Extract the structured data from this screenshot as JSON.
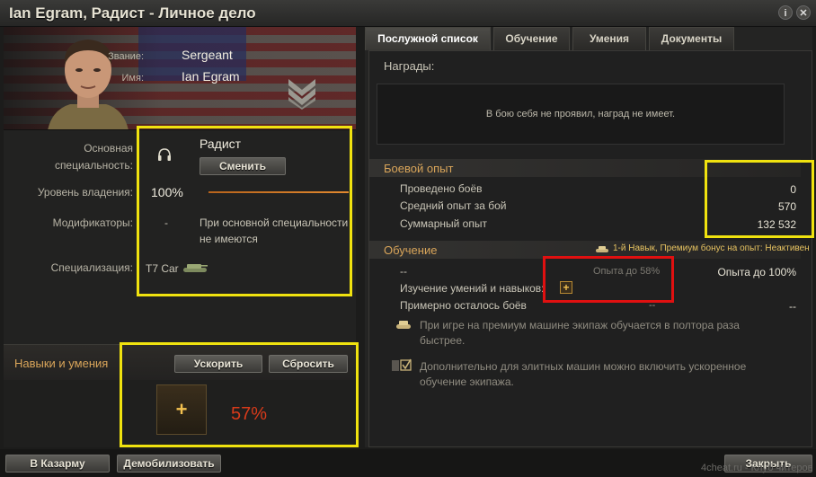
{
  "window": {
    "title": "Ian Egram, Радист - Личное дело",
    "help_icon": "info-icon",
    "close_icon": "close-icon"
  },
  "profile": {
    "rank_label": "Звание:",
    "rank_value": "Sergeant",
    "name_label": "Имя:",
    "name_value": "Ian Egram",
    "rank_insignia": "sergeant-chevron-icon"
  },
  "details": {
    "specialty_label_1": "Основная",
    "specialty_label_2": "специальность:",
    "specialty_value": "Радист",
    "specialty_icon": "headphones-icon",
    "change_button": "Сменить",
    "proficiency_label": "Уровень владения:",
    "proficiency_value": "100%",
    "proficiency_fraction": 1.0,
    "modifiers_label": "Модификаторы:",
    "modifiers_dash": "-",
    "modifiers_text_1": "При основной специальности",
    "modifiers_text_2": "не имеются",
    "specialization_label": "Специализация:",
    "specialization_value": "T7 Car",
    "specialization_icon": "tank-icon"
  },
  "skills": {
    "title": "Навыки и умения",
    "accelerate_button": "Ускорить",
    "reset_button": "Сбросить",
    "slot_icon": "plus-icon",
    "progress_text": "57%"
  },
  "tabs": [
    {
      "label": "Послужной список",
      "active": true
    },
    {
      "label": "Обучение",
      "active": false
    },
    {
      "label": "Умения",
      "active": false
    },
    {
      "label": "Документы",
      "active": false
    }
  ],
  "awards": {
    "title": "Награды:",
    "empty_text": "В бою себя не проявил, наград не имеет."
  },
  "combat": {
    "title": "Боевой опыт",
    "rows": [
      {
        "label": "Проведено боёв",
        "value": "0"
      },
      {
        "label": "Средний опыт за бой",
        "value": "570"
      },
      {
        "label": "Суммарный опыт",
        "value": "132 532"
      }
    ]
  },
  "training": {
    "title": "Обучение",
    "bonus_text": "1-й Навык, Премиум бонус на опыт: Неактивен",
    "bonus_icon": "tank-icon",
    "row1_label": "--",
    "row1_mid": "Опыта до 58%",
    "row1_right": "Опыта до 100%",
    "row2_label": "Изучение умений и навыков:",
    "row2_icon": "plus-icon",
    "row3_label": "Примерно осталось боёв",
    "row3_mid": "--",
    "row3_right": "--",
    "note1_icon": "tank-icon",
    "note1_line1": "При игре на премиум машине экипаж обучается в полтора раза",
    "note1_line2": "быстрее.",
    "note2_icon": "checkbox-icon",
    "note2_line1": "Дополнительно для элитных машин можно включить ускоренное",
    "note2_line2": "обучение экипажа."
  },
  "footer": {
    "barracks_button": "В Казарму",
    "demobilize_button": "Демобилизовать",
    "close_button": "Закрыть",
    "watermark": "4cheat.ru - Клуб читеров"
  },
  "colors": {
    "highlight_yellow": "#f0e20f",
    "highlight_red": "#e01010",
    "section_orange": "#d9a55a",
    "percent_red": "#d83a1a"
  }
}
